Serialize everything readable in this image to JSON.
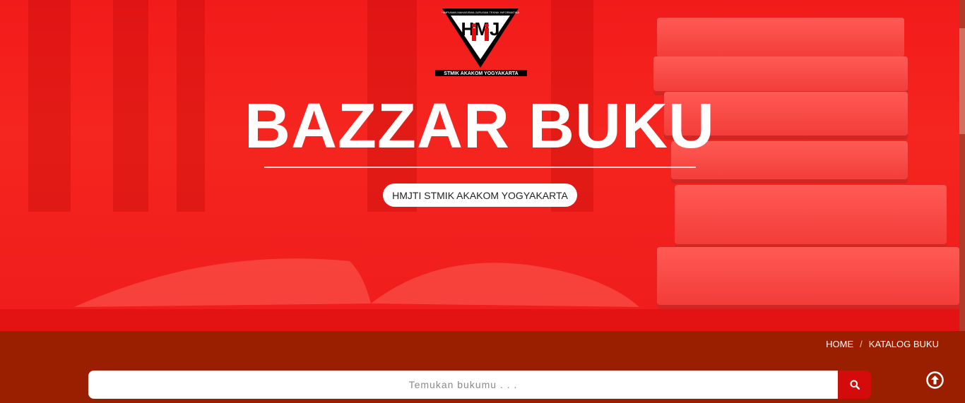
{
  "hero": {
    "logo": {
      "top_text": "HIMPUNAN MAHASISWA JURUSAN TEKNIK INFORMATIKA",
      "initials": "HMJ",
      "bottom_text": "STMIK AKAKOM YOGYAKARTA"
    },
    "title": "BAZZAR BUKU",
    "badge": "HMJTI STMIK AKAKOM YOGYAKARTA"
  },
  "breadcrumb": {
    "items": [
      "HOME",
      "KATALOG BUKU"
    ],
    "separator": "/"
  },
  "search": {
    "placeholder": "Temukan bukumu . . .",
    "button_icon": "search-icon"
  },
  "scroll_top": {
    "icon": "arrow-up-circle-icon"
  },
  "colors": {
    "hero_red": "#f21b1b",
    "footer_band": "#9a1f00",
    "search_button": "#d40b0b"
  }
}
